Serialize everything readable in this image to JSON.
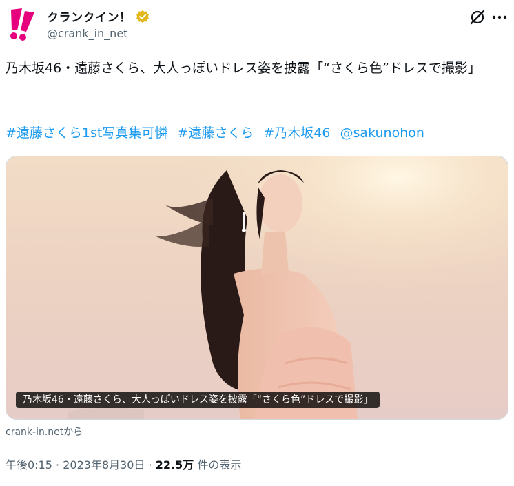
{
  "author": {
    "display_name": "クランクイン！",
    "handle": "@crank_in_net",
    "avatar_icon": "crankin-logo-icon",
    "verified_icon": "verified-badge-icon",
    "brand_color": "#e6007e",
    "verified_color": "#e2b719"
  },
  "actions": {
    "grok_icon": "grok-icon",
    "more_icon": "more-options-icon"
  },
  "tweet": {
    "text": "乃木坂46・遠藤さくら、大人っぽいドレス姿を披露「“さくら色”ドレスで撮影」",
    "hashtags": [
      "#遠藤さくら1st写真集可憐",
      "#遠藤さくら",
      "#乃木坂46"
    ],
    "mention": "@sakunohon",
    "link_color": "#1d9bf0"
  },
  "media": {
    "caption": "乃木坂46・遠藤さくら、大人っぽいドレス姿を披露「“さくら色”ドレスで撮影」",
    "source": "crank-in.netから"
  },
  "meta": {
    "time": "午後0:15",
    "separator": "·",
    "date": "2023年8月30日",
    "views": "22.5万",
    "views_label": "件の表示"
  }
}
